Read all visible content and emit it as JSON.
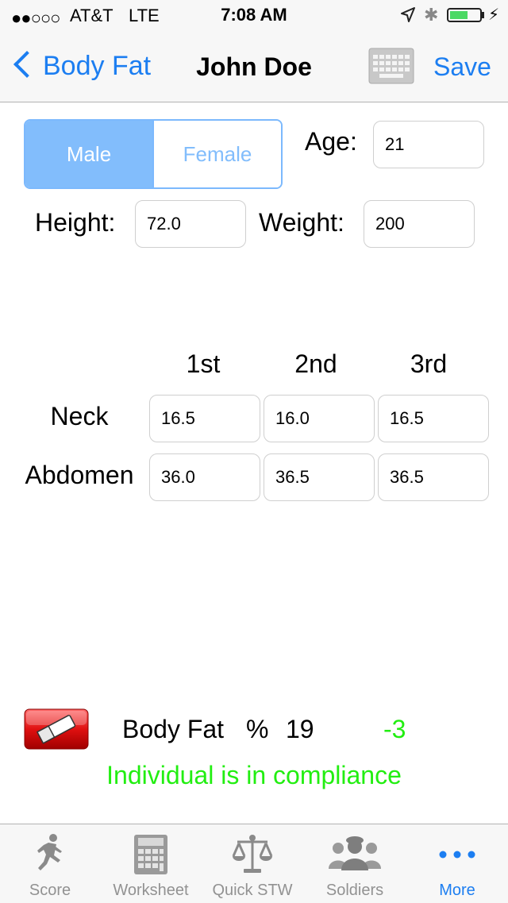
{
  "status_bar": {
    "signal": "●●○○○",
    "carrier": "AT&T",
    "network": "LTE",
    "time": "7:08 AM",
    "bluetooth_icon": "✱",
    "battery_level": 0.6
  },
  "nav": {
    "back_label": "Body Fat",
    "title": "John Doe",
    "save_label": "Save",
    "keyboard_icon": "keyboard-icon"
  },
  "gender": {
    "options": [
      "Male",
      "Female"
    ],
    "selected": "Male"
  },
  "fields": {
    "age_label": "Age:",
    "age": "21",
    "height_label": "Height:",
    "height": "72.0",
    "weight_label": "Weight:",
    "weight": "200"
  },
  "measurements": {
    "columns": [
      "1st",
      "2nd",
      "3rd"
    ],
    "rows": [
      {
        "label": "Neck",
        "values": [
          "16.5",
          "16.0",
          "16.5"
        ]
      },
      {
        "label": "Abdomen",
        "values": [
          "36.0",
          "36.5",
          "36.5"
        ]
      }
    ]
  },
  "result": {
    "label": "Body Fat",
    "percent_sign": "%",
    "value": "19",
    "difference": "-3",
    "message": "Individual is in compliance"
  },
  "tab_bar": {
    "tabs": [
      {
        "label": "Score",
        "icon": "runner-icon"
      },
      {
        "label": "Worksheet",
        "icon": "calculator-icon"
      },
      {
        "label": "Quick STW",
        "icon": "scale-icon"
      },
      {
        "label": "Soldiers",
        "icon": "soldiers-icon"
      },
      {
        "label": "More",
        "icon": "more-icon"
      }
    ],
    "active": "More"
  },
  "colors": {
    "accent": "#1c7ef1",
    "segment": "#82bdfc",
    "compliance": "#22ee11"
  }
}
